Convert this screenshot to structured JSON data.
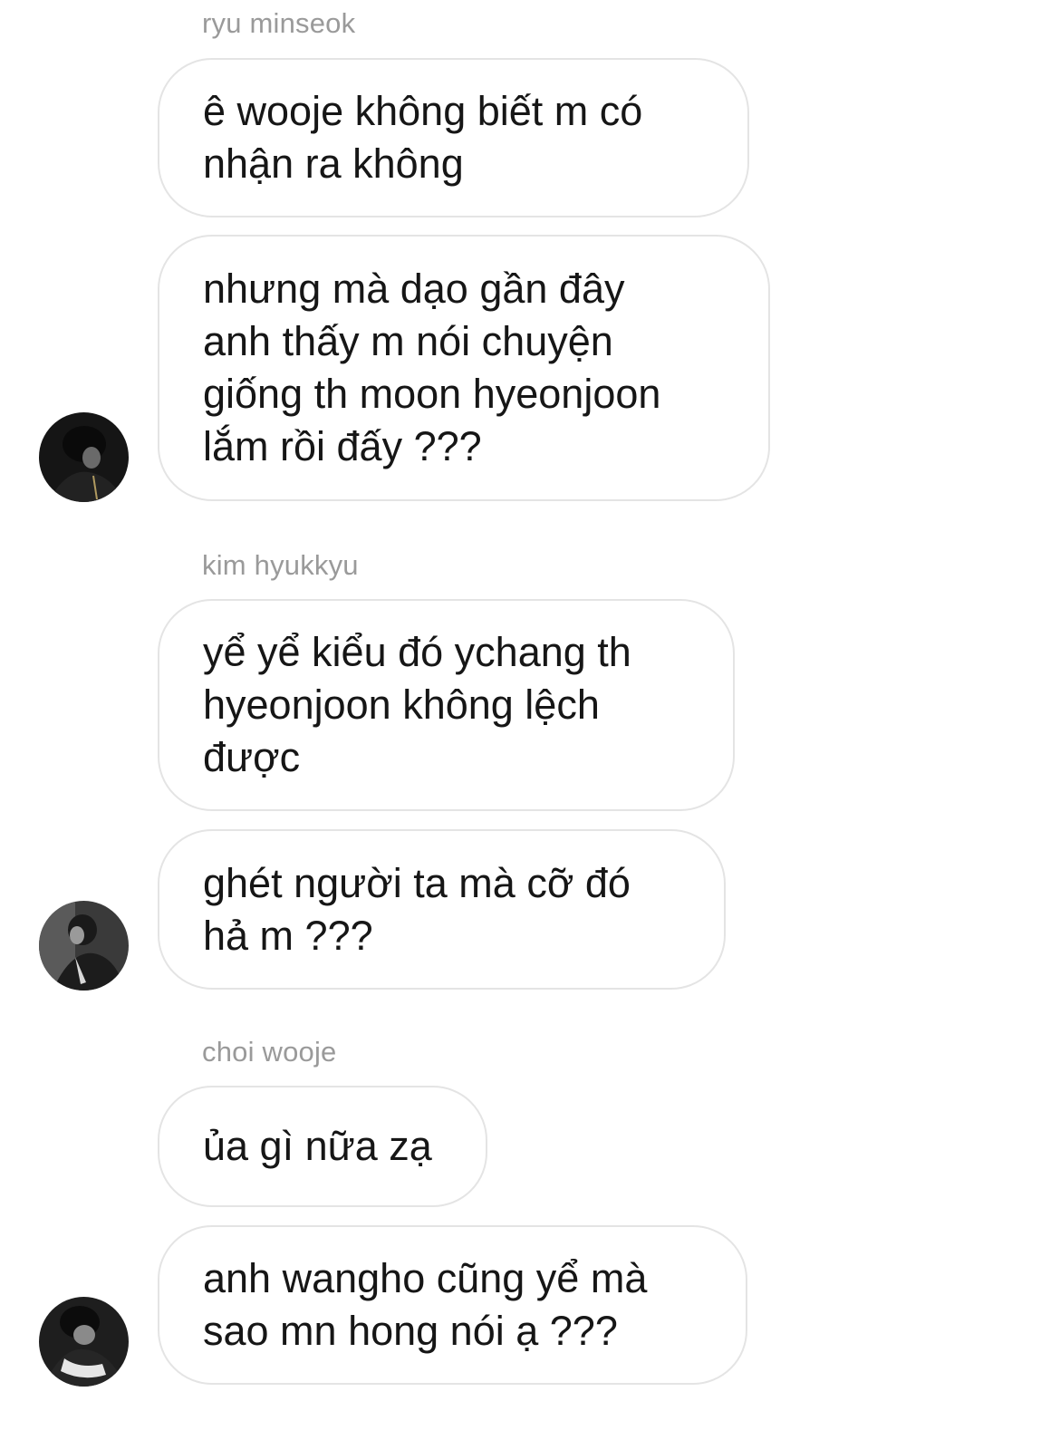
{
  "conversation": {
    "groups": [
      {
        "sender": "ryu minseok",
        "avatar_icon": "user-avatar-icon",
        "messages": [
          "ê wooje không biết m có\nnhận ra không",
          "nhưng mà dạo gần đây\nanh thấy m nói chuyện\ngiống th moon hyeonjoon\nlắm rồi đấy ???"
        ]
      },
      {
        "sender": "kim hyukkyu",
        "avatar_icon": "user-avatar-icon",
        "messages": [
          "yể yể kiểu đó ychang th\nhyeonjoon không lệch\nđược",
          "ghét người ta mà cỡ đó\nhả m ???"
        ]
      },
      {
        "sender": "choi wooje",
        "avatar_icon": "user-avatar-icon",
        "messages": [
          "ủa gì nữa zạ",
          "anh wangho cũng yể mà\nsao mn hong nói ạ ???"
        ]
      }
    ]
  },
  "colors": {
    "bubble_border": "#e4e4e4",
    "sender_name": "#9a9a9a",
    "message_text": "#161616",
    "background": "#ffffff"
  }
}
